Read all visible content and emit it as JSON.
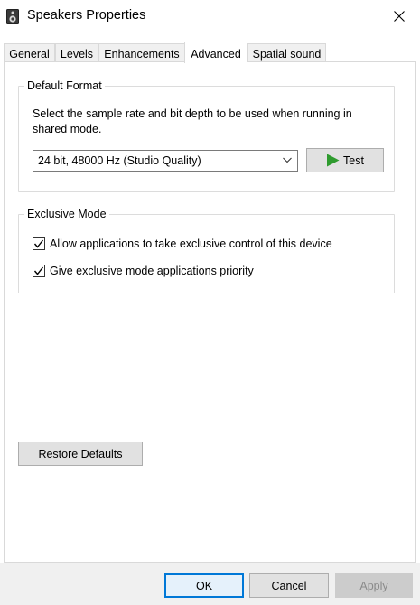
{
  "window": {
    "title": "Speakers Properties",
    "icon": "speaker-icon",
    "close_icon": "close-icon"
  },
  "tabs": [
    {
      "label": "General",
      "active": false
    },
    {
      "label": "Levels",
      "active": false
    },
    {
      "label": "Enhancements",
      "active": false
    },
    {
      "label": "Advanced",
      "active": true
    },
    {
      "label": "Spatial sound",
      "active": false
    }
  ],
  "default_format": {
    "legend": "Default Format",
    "description": "Select the sample rate and bit depth to be used when running in shared mode.",
    "selected_format": "24 bit, 48000 Hz (Studio Quality)",
    "test_label": "Test",
    "test_icon": "play-icon",
    "play_color": "#2e9b2e"
  },
  "exclusive_mode": {
    "legend": "Exclusive Mode",
    "options": [
      {
        "label": "Allow applications to take exclusive control of this device",
        "checked": true
      },
      {
        "label": "Give exclusive mode applications priority",
        "checked": true
      }
    ]
  },
  "restore_defaults_label": "Restore Defaults",
  "footer": {
    "ok_label": "OK",
    "cancel_label": "Cancel",
    "apply_label": "Apply",
    "accent_color": "#0078d7"
  }
}
